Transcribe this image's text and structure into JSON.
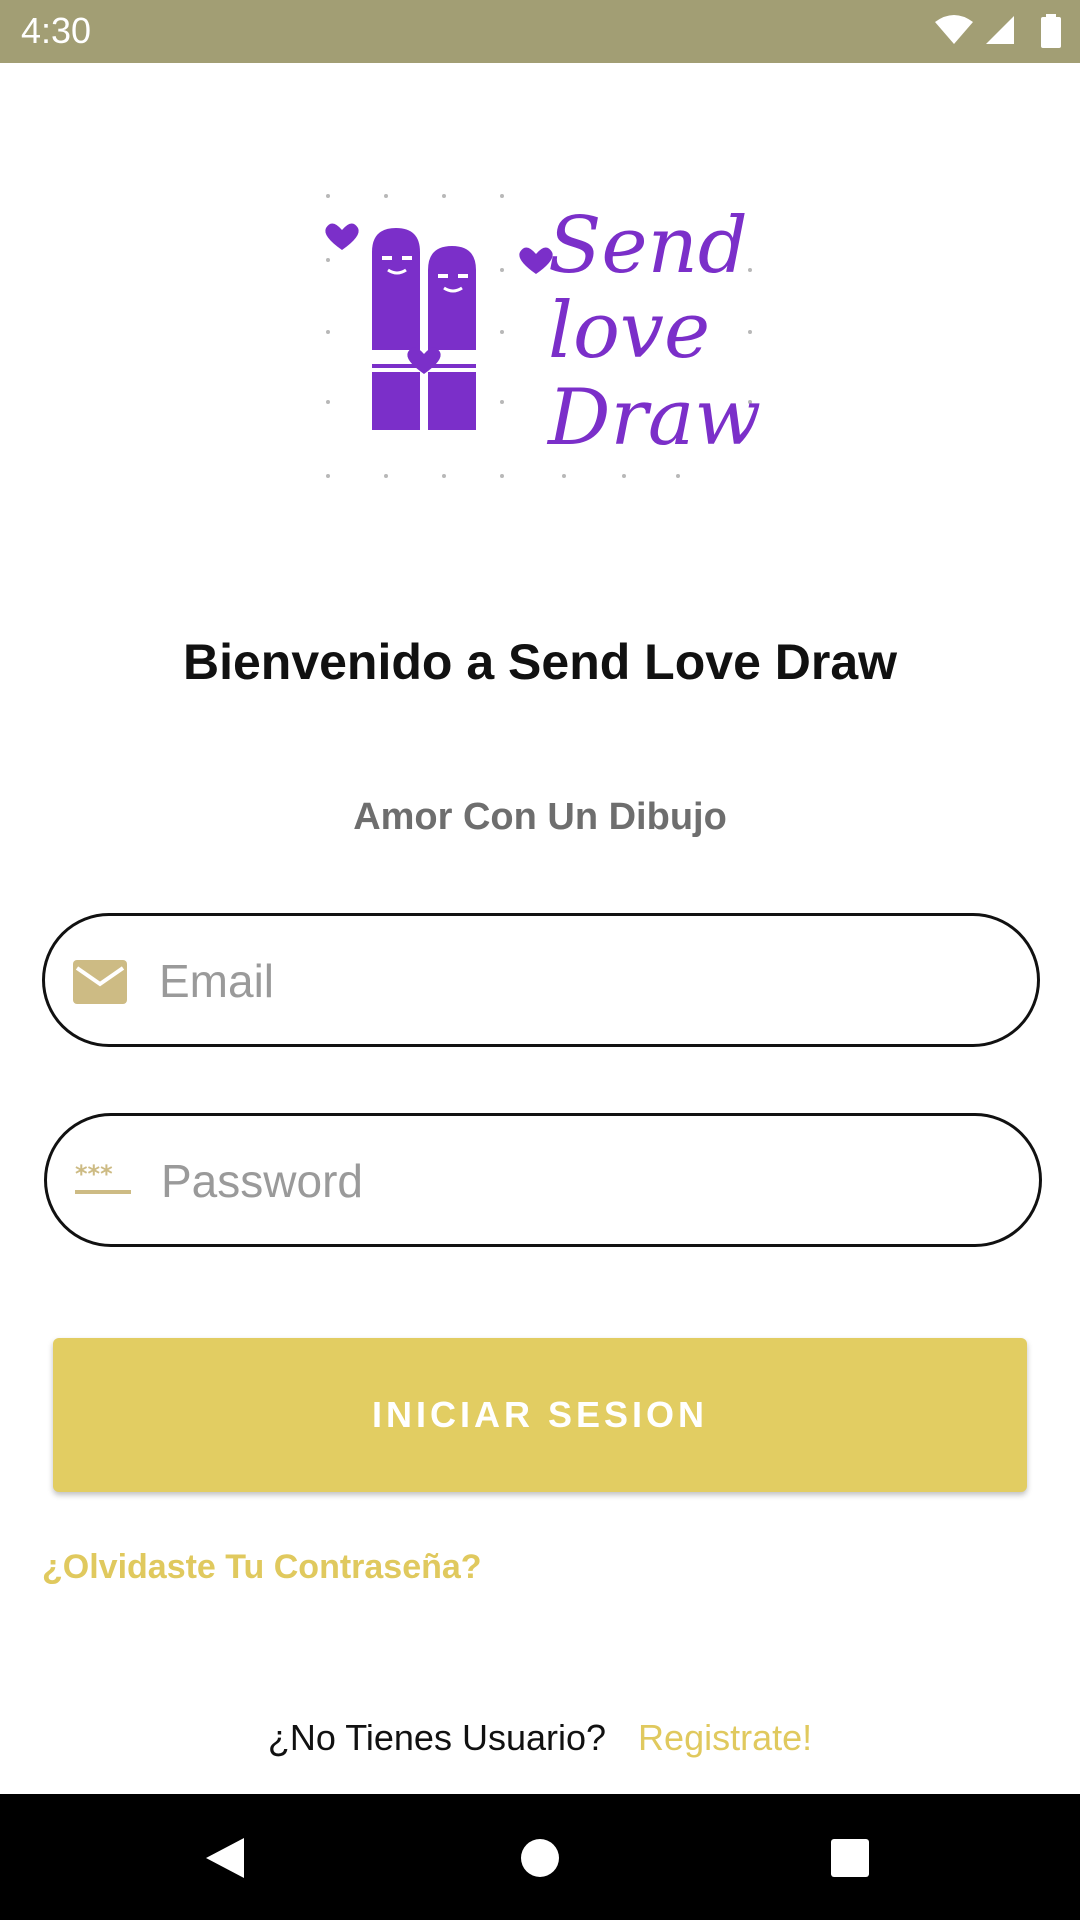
{
  "status_bar": {
    "time": "4:30",
    "icons": [
      "wifi-icon",
      "cell-signal-icon",
      "battery-icon"
    ],
    "background_color": "#a29e74"
  },
  "logo": {
    "text_lines": [
      "Send",
      "love",
      "Draw"
    ],
    "color": "#7b2fc9"
  },
  "welcome_title": "Bienvenido a Send Love Draw",
  "subtitle": "Amor Con Un Dibujo",
  "email_field": {
    "placeholder": "Email",
    "value": "",
    "icon": "envelope-icon"
  },
  "password_field": {
    "placeholder": "Password",
    "value": "",
    "icon": "password-icon"
  },
  "login_button": {
    "label": "INICIAR SESION",
    "color": "#e2cd62"
  },
  "forgot_password": "¿Olvidaste Tu Contraseña?",
  "register": {
    "question": "¿No Tienes Usuario?",
    "link": "Registrate!"
  },
  "nav_bar": {
    "icons": [
      "back-icon",
      "home-icon",
      "recents-icon"
    ]
  }
}
